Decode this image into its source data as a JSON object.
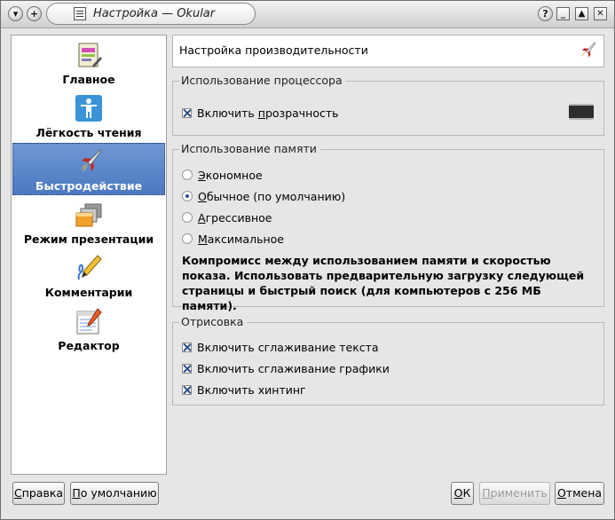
{
  "window": {
    "title": "Настройка — Okular"
  },
  "sidebar": {
    "items": [
      {
        "label": "Главное",
        "icon": "general-settings-icon"
      },
      {
        "label": "Лёгкость чтения",
        "icon": "accessibility-icon"
      },
      {
        "label": "Быстродействие",
        "icon": "rocket-icon",
        "selected": true
      },
      {
        "label": "Режим презентации",
        "icon": "presentation-icon"
      },
      {
        "label": "Комментарии",
        "icon": "annotations-pen-icon"
      },
      {
        "label": "Редактор",
        "icon": "editor-notepad-icon"
      }
    ]
  },
  "page": {
    "header": "Настройка производительности",
    "cpu": {
      "title": "Использование процессора",
      "transparency_pre": "Включить ",
      "transparency_acc": "п",
      "transparency_post": "розрачность",
      "transparency_checked": true
    },
    "memory": {
      "title": "Использование памяти",
      "options": [
        {
          "acc": "Э",
          "rest": "кономное",
          "checked": false
        },
        {
          "acc": "О",
          "rest": "бычное (по умолчанию)",
          "checked": true
        },
        {
          "acc": "А",
          "rest": "грессивное",
          "checked": false
        },
        {
          "acc": "М",
          "rest": "аксимальное",
          "checked": false
        }
      ],
      "description": "Компромисс между использованием памяти и скоростью показа. Использовать предварительную загрузку следующей страницы и быстрый поиск (для компьютеров с 256 МБ памяти)."
    },
    "render": {
      "title": "Отрисовка",
      "options": [
        {
          "label": "Включить сглаживание текста",
          "checked": true
        },
        {
          "label": "Включить сглаживание графики",
          "checked": true
        },
        {
          "label": "Включить хинтинг",
          "checked": true
        }
      ]
    }
  },
  "buttons": {
    "help": {
      "acc": "С",
      "rest": "правка"
    },
    "defaults": {
      "acc": "П",
      "rest": "о умолчанию"
    },
    "ok": {
      "acc": "О",
      "rest": "К"
    },
    "apply": {
      "acc": "П",
      "rest": "рименить"
    },
    "cancel": {
      "acc": "О",
      "rest": "тмена"
    }
  },
  "colors": {
    "selection": "#5a86c9",
    "check": "#2b4f8a"
  }
}
